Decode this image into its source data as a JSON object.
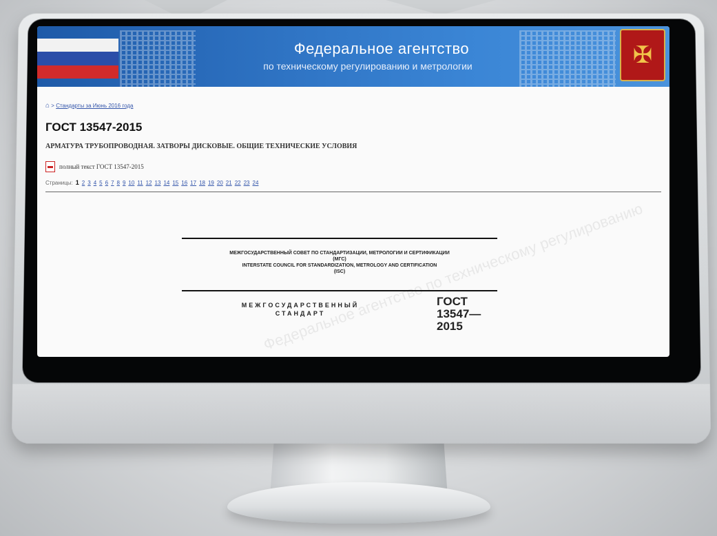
{
  "banner": {
    "title": "Федеральное агентство",
    "subtitle": "по техническому регулированию и метрологии",
    "brand_color": "#2f74c4"
  },
  "breadcrumb": {
    "home_icon": "home-icon",
    "separator": ">",
    "link": "Стандарты за Июнь 2016 года"
  },
  "document": {
    "title": "ГОСТ 13547-2015",
    "subtitle": "АРМАТУРА ТРУБОПРОВОДНАЯ. ЗАТВОРЫ ДИСКОВЫЕ. ОБЩИЕ ТЕХНИЧЕСКИЕ УСЛОВИЯ",
    "fulltext_label": "полный текст ГОСТ 13547-2015"
  },
  "pagination": {
    "label": "Страницы:",
    "current": "1",
    "pages": [
      "2",
      "3",
      "4",
      "5",
      "6",
      "7",
      "8",
      "9",
      "10",
      "11",
      "12",
      "13",
      "14",
      "15",
      "16",
      "17",
      "18",
      "19",
      "20",
      "21",
      "22",
      "23",
      "24"
    ]
  },
  "doc_page": {
    "council_ru": "МЕЖГОСУДАРСТВЕННЫЙ СОВЕТ ПО СТАНДАРТИЗАЦИИ, МЕТРОЛОГИИ И СЕРТИФИКАЦИИ",
    "council_ru_abbr": "(МГС)",
    "council_en": "INTERSTATE COUNCIL FOR STANDARDIZATION, METROLOGY AND CERTIFICATION",
    "council_en_abbr": "(ISC)",
    "standard_line1": "МЕЖГОСУДАРСТВЕННЫЙ",
    "standard_line2": "СТАНДАРТ",
    "code_line1": "ГОСТ",
    "code_line2": "13547—",
    "code_line3": "2015",
    "watermark": "Федеральное агентство по техническому регулированию"
  }
}
